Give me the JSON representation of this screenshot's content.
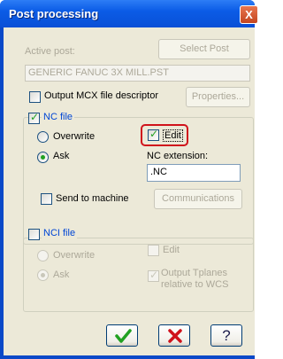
{
  "window": {
    "title": "Post processing",
    "close": "X"
  },
  "active_post": {
    "label": "Active post:",
    "value": "GENERIC FANUC 3X MILL.PST",
    "select_button": "Select Post"
  },
  "mcx": {
    "label": "Output MCX file descriptor",
    "checked": false,
    "properties_button": "Properties..."
  },
  "nc_file": {
    "label": "NC file",
    "checked": true,
    "overwrite": "Overwrite",
    "ask": "Ask",
    "selected": "Ask",
    "edit": {
      "label": "Edit",
      "checked": true
    },
    "extension_label": "NC extension:",
    "extension_value": ".NC",
    "send_to_machine": {
      "label": "Send to machine",
      "checked": false
    },
    "communications_button": "Communications"
  },
  "nci_file": {
    "label": "NCI file",
    "checked": false,
    "overwrite": "Overwrite",
    "ask": "Ask",
    "selected": "Ask",
    "edit": {
      "label": "Edit",
      "checked": false
    },
    "output_tplanes": {
      "label": "Output Tplanes relative to WCS",
      "checked": true
    }
  },
  "footer": {
    "ok_icon": "check-icon",
    "cancel_icon": "x-icon",
    "help_icon": "question-icon",
    "help_glyph": "?"
  },
  "colors": {
    "accent": "#0046d5",
    "ok": "#21a121",
    "cancel": "#d0131c",
    "highlight": "#d0131c"
  }
}
